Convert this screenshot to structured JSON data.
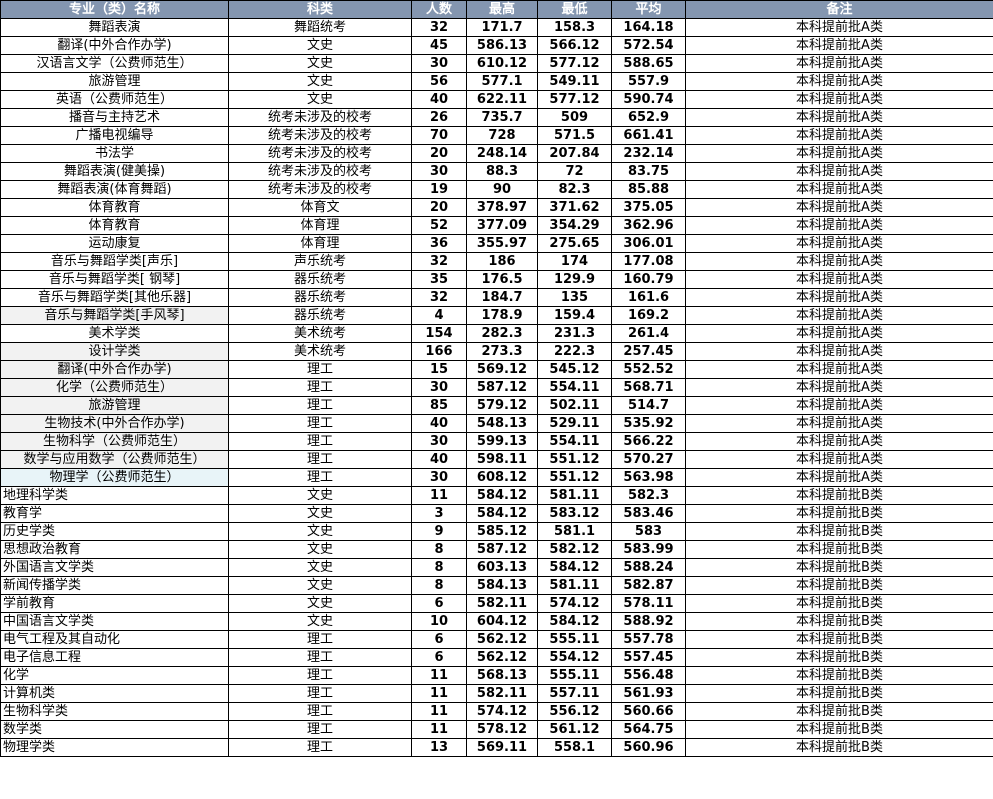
{
  "headers": [
    "专业（类）名称",
    "科类",
    "人数",
    "最高",
    "最低",
    "平均",
    "备注"
  ],
  "rows": [
    {
      "name": "舞蹈表演",
      "kelei": "舞蹈统考",
      "count": "32",
      "high": "171.7",
      "low": "158.3",
      "avg": "164.18",
      "note": "本科提前批A类"
    },
    {
      "name": "翻译(中外合作办学)",
      "kelei": "文史",
      "count": "45",
      "high": "586.13",
      "low": "566.12",
      "avg": "572.54",
      "note": "本科提前批A类"
    },
    {
      "name": "汉语言文学（公费师范生）",
      "kelei": "文史",
      "count": "30",
      "high": "610.12",
      "low": "577.12",
      "avg": "588.65",
      "note": "本科提前批A类"
    },
    {
      "name": "旅游管理",
      "kelei": "文史",
      "count": "56",
      "high": "577.1",
      "low": "549.11",
      "avg": "557.9",
      "note": "本科提前批A类"
    },
    {
      "name": "英语（公费师范生）",
      "kelei": "文史",
      "count": "40",
      "high": "622.11",
      "low": "577.12",
      "avg": "590.74",
      "note": "本科提前批A类"
    },
    {
      "name": "播音与主持艺术",
      "kelei": "统考未涉及的校考",
      "count": "26",
      "high": "735.7",
      "low": "509",
      "avg": "652.9",
      "note": "本科提前批A类"
    },
    {
      "name": "广播电视编导",
      "kelei": "统考未涉及的校考",
      "count": "70",
      "high": "728",
      "low": "571.5",
      "avg": "661.41",
      "note": "本科提前批A类"
    },
    {
      "name": "书法学",
      "kelei": "统考未涉及的校考",
      "count": "20",
      "high": "248.14",
      "low": "207.84",
      "avg": "232.14",
      "note": "本科提前批A类"
    },
    {
      "name": "舞蹈表演(健美操)",
      "kelei": "统考未涉及的校考",
      "count": "30",
      "high": "88.3",
      "low": "72",
      "avg": "83.75",
      "note": "本科提前批A类"
    },
    {
      "name": "舞蹈表演(体育舞蹈)",
      "kelei": "统考未涉及的校考",
      "count": "19",
      "high": "90",
      "low": "82.3",
      "avg": "85.88",
      "note": "本科提前批A类"
    },
    {
      "name": "体育教育",
      "kelei": "体育文",
      "count": "20",
      "high": "378.97",
      "low": "371.62",
      "avg": "375.05",
      "note": "本科提前批A类"
    },
    {
      "name": "体育教育",
      "kelei": "体育理",
      "count": "52",
      "high": "377.09",
      "low": "354.29",
      "avg": "362.96",
      "note": "本科提前批A类"
    },
    {
      "name": "运动康复",
      "kelei": "体育理",
      "count": "36",
      "high": "355.97",
      "low": "275.65",
      "avg": "306.01",
      "note": "本科提前批A类"
    },
    {
      "name": "音乐与舞蹈学类[声乐]",
      "kelei": "声乐统考",
      "count": "32",
      "high": "186",
      "low": "174",
      "avg": "177.08",
      "note": "本科提前批A类"
    },
    {
      "name": "音乐与舞蹈学类[ 钢琴]",
      "kelei": "器乐统考",
      "count": "35",
      "high": "176.5",
      "low": "129.9",
      "avg": "160.79",
      "note": "本科提前批A类"
    },
    {
      "name": "音乐与舞蹈学类[其他乐器]",
      "kelei": "器乐统考",
      "count": "32",
      "high": "184.7",
      "low": "135",
      "avg": "161.6",
      "note": "本科提前批A类"
    },
    {
      "name": "音乐与舞蹈学类[手风琴]",
      "kelei": "器乐统考",
      "count": "4",
      "high": "178.9",
      "low": "159.4",
      "avg": "169.2",
      "note": "本科提前批A类"
    },
    {
      "name": "美术学类",
      "kelei": "美术统考",
      "count": "154",
      "high": "282.3",
      "low": "231.3",
      "avg": "261.4",
      "note": "本科提前批A类"
    },
    {
      "name": "设计学类",
      "kelei": "美术统考",
      "count": "166",
      "high": "273.3",
      "low": "222.3",
      "avg": "257.45",
      "note": "本科提前批A类"
    },
    {
      "name": "翻译(中外合作办学)",
      "kelei": "理工",
      "count": "15",
      "high": "569.12",
      "low": "545.12",
      "avg": "552.52",
      "note": "本科提前批A类"
    },
    {
      "name": "化学（公费师范生）",
      "kelei": "理工",
      "count": "30",
      "high": "587.12",
      "low": "554.11",
      "avg": "568.71",
      "note": "本科提前批A类"
    },
    {
      "name": "旅游管理",
      "kelei": "理工",
      "count": "85",
      "high": "579.12",
      "low": "502.11",
      "avg": "514.7",
      "note": "本科提前批A类"
    },
    {
      "name": "生物技术(中外合作办学)",
      "kelei": "理工",
      "count": "40",
      "high": "548.13",
      "low": "529.11",
      "avg": "535.92",
      "note": "本科提前批A类"
    },
    {
      "name": "生物科学（公费师范生）",
      "kelei": "理工",
      "count": "30",
      "high": "599.13",
      "low": "554.11",
      "avg": "566.22",
      "note": "本科提前批A类"
    },
    {
      "name": "数学与应用数学（公费师范生）",
      "kelei": "理工",
      "count": "40",
      "high": "598.11",
      "low": "551.12",
      "avg": "570.27",
      "note": "本科提前批A类"
    },
    {
      "name": "物理学（公费师范生）",
      "kelei": "理工",
      "count": "30",
      "high": "608.12",
      "low": "551.12",
      "avg": "563.98",
      "note": "本科提前批A类"
    },
    {
      "name": "地理科学类",
      "kelei": "文史",
      "count": "11",
      "high": "584.12",
      "low": "581.11",
      "avg": "582.3",
      "note": "本科提前批B类"
    },
    {
      "name": "教育学",
      "kelei": "文史",
      "count": "3",
      "high": "584.12",
      "low": "583.12",
      "avg": "583.46",
      "note": "本科提前批B类"
    },
    {
      "name": "历史学类",
      "kelei": "文史",
      "count": "9",
      "high": "585.12",
      "low": "581.1",
      "avg": "583",
      "note": "本科提前批B类"
    },
    {
      "name": "思想政治教育",
      "kelei": "文史",
      "count": "8",
      "high": "587.12",
      "low": "582.12",
      "avg": "583.99",
      "note": "本科提前批B类"
    },
    {
      "name": "外国语言文学类",
      "kelei": "文史",
      "count": "8",
      "high": "603.13",
      "low": "584.12",
      "avg": "588.24",
      "note": "本科提前批B类"
    },
    {
      "name": "新闻传播学类",
      "kelei": "文史",
      "count": "8",
      "high": "584.13",
      "low": "581.11",
      "avg": "582.87",
      "note": "本科提前批B类"
    },
    {
      "name": "学前教育",
      "kelei": "文史",
      "count": "6",
      "high": "582.11",
      "low": "574.12",
      "avg": "578.11",
      "note": "本科提前批B类"
    },
    {
      "name": "中国语言文学类",
      "kelei": "文史",
      "count": "10",
      "high": "604.12",
      "low": "584.12",
      "avg": "588.92",
      "note": "本科提前批B类"
    },
    {
      "name": "电气工程及其自动化",
      "kelei": "理工",
      "count": "6",
      "high": "562.12",
      "low": "555.11",
      "avg": "557.78",
      "note": "本科提前批B类"
    },
    {
      "name": "电子信息工程",
      "kelei": "理工",
      "count": "6",
      "high": "562.12",
      "low": "554.12",
      "avg": "557.45",
      "note": "本科提前批B类"
    },
    {
      "name": "化学",
      "kelei": "理工",
      "count": "11",
      "high": "568.13",
      "low": "555.11",
      "avg": "556.48",
      "note": "本科提前批B类"
    },
    {
      "name": "计算机类",
      "kelei": "理工",
      "count": "11",
      "high": "582.11",
      "low": "557.11",
      "avg": "561.93",
      "note": "本科提前批B类"
    },
    {
      "name": "生物科学类",
      "kelei": "理工",
      "count": "11",
      "high": "574.12",
      "low": "556.12",
      "avg": "560.66",
      "note": "本科提前批B类"
    },
    {
      "name": "数学类",
      "kelei": "理工",
      "count": "11",
      "high": "578.12",
      "low": "561.12",
      "avg": "564.75",
      "note": "本科提前批B类"
    },
    {
      "name": "物理学类",
      "kelei": "理工",
      "count": "13",
      "high": "569.11",
      "low": "558.1",
      "avg": "560.96",
      "note": "本科提前批B类"
    }
  ],
  "colors": {
    "header_bg": "#8496b0",
    "header_text": "#ffffff",
    "shade_grey": "#f2f2f2",
    "shade_blue": "#e8f4f8"
  }
}
